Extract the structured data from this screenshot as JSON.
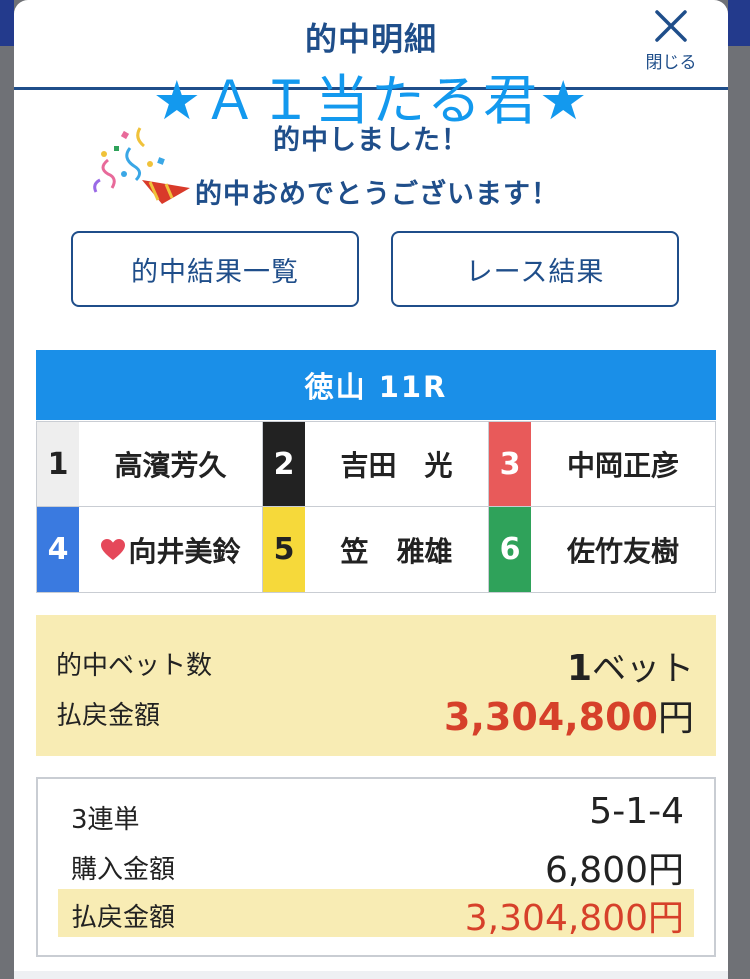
{
  "modal": {
    "title": "的中明細",
    "close_label": "閉じる",
    "overlay_text": "★ＡＩ当たる君★",
    "hit_message": "的中しました！",
    "congrats_message": "的中おめでとうございます！"
  },
  "buttons": {
    "hit_results_label": "的中結果一覧",
    "race_results_label": "レース結果"
  },
  "race": {
    "header": "徳山 11R",
    "racers": [
      {
        "waku": "1",
        "name": "高濱芳久",
        "bg": "#eeeeee",
        "fg": "#222222"
      },
      {
        "waku": "2",
        "name": "吉田　光",
        "bg": "#222222",
        "fg": "#ffffff"
      },
      {
        "waku": "3",
        "name": "中岡正彦",
        "bg": "#e85a5a",
        "fg": "#ffffff"
      },
      {
        "waku": "4",
        "name": "向井美鈴",
        "bg": "#3a7ae0",
        "fg": "#ffffff",
        "icon": "heart-icon"
      },
      {
        "waku": "5",
        "name": "笠　雅雄",
        "bg": "#f6d93a",
        "fg": "#222222"
      },
      {
        "waku": "6",
        "name": "佐竹友樹",
        "bg": "#2fa25a",
        "fg": "#ffffff"
      }
    ]
  },
  "summary": {
    "bets_label": "的中ベット数",
    "bets_count": "1",
    "bets_unit": "ベット",
    "payout_label": "払戻金額",
    "payout_amount": "3,304,800",
    "payout_unit": "円"
  },
  "detail": {
    "type_label": "3連単",
    "type_value": "5-1-4",
    "purchase_label": "購入金額",
    "purchase_value": "6,800円",
    "payout_label": "払戻金額",
    "payout_value": "3,304,800円"
  },
  "colors": {
    "primary": "#1f4e8a",
    "race_header": "#1a8fe8",
    "highlight": "#f8ecb4",
    "payout": "#d6402a",
    "overlay": "#1399ee"
  }
}
